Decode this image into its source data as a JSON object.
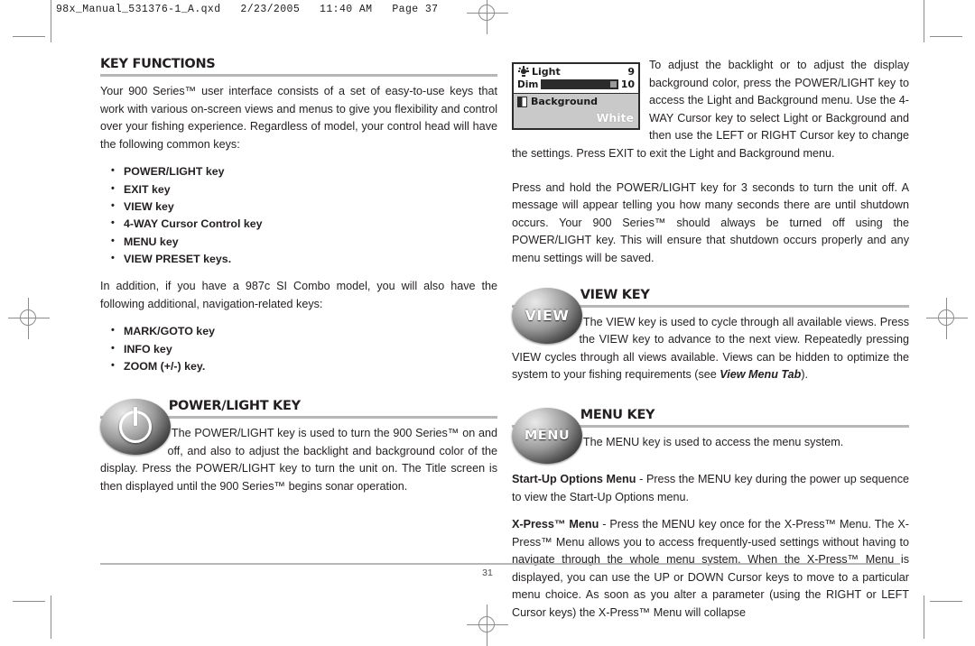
{
  "file_header": "98x_Manual_531376-1_A.qxd   2/23/2005   11:40 AM   Page 37",
  "left_column": {
    "section_title": "KEY FUNCTIONS",
    "intro_paragraph": "Your 900 Series™ user interface consists of a set of easy-to-use keys that work with various on-screen views and menus to give you flexibility and control over your fishing experience. Regardless of model, your control head will have the following common keys:",
    "common_keys": [
      "POWER/LIGHT key",
      "EXIT key",
      "VIEW key",
      "4-WAY Cursor Control key",
      "MENU key",
      "VIEW PRESET keys."
    ],
    "additional_paragraph": "In addition, if you have a 987c SI Combo model, you will also have the following additional, navigation-related keys:",
    "additional_keys": [
      "MARK/GOTO key",
      "INFO key",
      "ZOOM (+/-) key."
    ],
    "power_light": {
      "title": "POWER/LIGHT KEY",
      "icon": "power-symbol-icon",
      "body": "The POWER/LIGHT key is used to turn the 900 Series™ on and off, and also to adjust the backlight and background color of the display. Press the POWER/LIGHT key to turn the unit on. The Title screen is then displayed until the 900 Series™ begins sonar operation."
    }
  },
  "right_column": {
    "lcd": {
      "light_icon": "light-bulb-icon",
      "light_label": "Light",
      "light_value": "9",
      "dim_label": "Dim",
      "dim_value": "10",
      "background_icon": "background-contrast-icon",
      "background_label": "Background",
      "background_value": "White"
    },
    "backlight_paragraph": "To adjust the backlight or to adjust the display background color, press the POWER/LIGHT key to access the Light and Background menu. Use the 4-WAY Cursor key to select Light or Background and then use the LEFT or RIGHT Cursor key to change the settings. Press EXIT to exit the Light and Background menu.",
    "shutdown_paragraph": "Press and hold the POWER/LIGHT key for 3 seconds to turn the unit off. A message will appear telling you how many seconds there are until shutdown occurs. Your 900 Series™ should always be turned off using the POWER/LIGHT key. This will ensure that shutdown occurs properly and any menu settings will be saved.",
    "view_key": {
      "button_label": "VIEW",
      "title": "VIEW KEY",
      "body_part1": "The VIEW key is used to cycle through all available views. Press the VIEW key to advance to the next view. Repeatedly pressing VIEW cycles through all views available. Views can be hidden to optimize the system to your fishing requirements (see ",
      "body_emphasis": "View Menu Tab",
      "body_part2": ")."
    },
    "menu_key": {
      "button_label": "MENU",
      "title": "MENU KEY",
      "body": "The MENU key is used to access the menu system.",
      "startup_bold": "Start-Up Options Menu",
      "startup_rest": " - Press the MENU key during the power up sequence to view the Start-Up Options menu.",
      "xpress_bold": "X-Press™ Menu",
      "xpress_rest": " - Press the MENU key once for the X-Press™ Menu. The X-Press™ Menu allows you to access frequently-used settings without having to navigate through the whole menu system. When the X-Press™ Menu is displayed, you can use the UP or DOWN Cursor keys to move to a particular menu choice. As soon as you alter a parameter (using the RIGHT or LEFT Cursor keys) the X-Press™ Menu will collapse"
    }
  },
  "footer": {
    "page_number": "31"
  }
}
